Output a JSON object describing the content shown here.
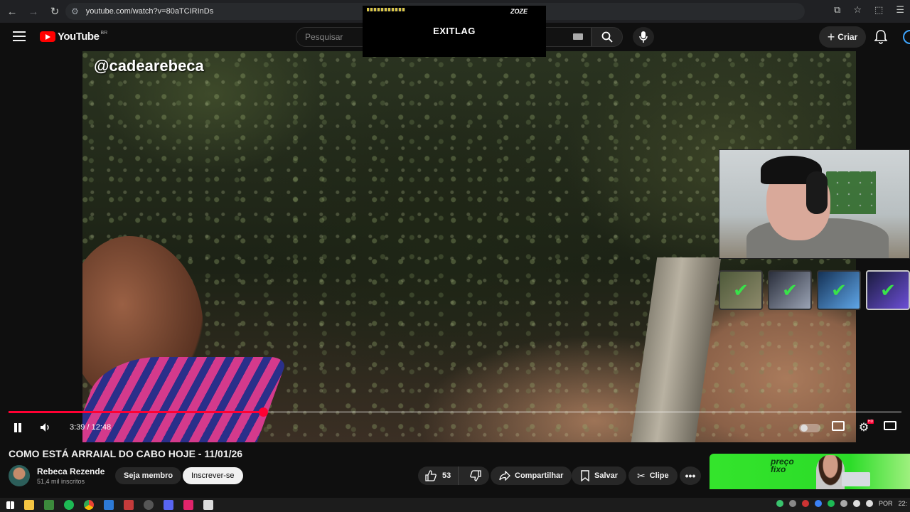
{
  "browser": {
    "url": "youtube.com/watch?v=80aTCIRInDs"
  },
  "header": {
    "logo_text": "YouTube",
    "region": "BR",
    "search_placeholder": "Pesquisar",
    "create_label": "Criar"
  },
  "ad_overlay": {
    "brand": "EXITLAG",
    "tag": "ZOZE"
  },
  "video": {
    "watermark": "@cadearebeca",
    "current_time": "3:39",
    "duration": "12:48",
    "time_display": "3:39 / 12:48",
    "progress_fraction": 0.285,
    "hd_badge": "HD"
  },
  "thumbs": [
    {
      "check": "✔"
    },
    {
      "check": "✔"
    },
    {
      "check": "✔"
    },
    {
      "check": "✔"
    }
  ],
  "info": {
    "title": "COMO ESTÁ ARRAIAL DO CABO HOJE - 11/01/26",
    "channel_name": "Rebeca Rezende",
    "subscribers": "51,4 mil inscritos",
    "member_label": "Seja membro",
    "subscribe_label": "Inscrever-se",
    "likes": "53",
    "share_label": "Compartilhar",
    "save_label": "Salvar",
    "clip_label": "Clipe"
  },
  "ad_banner": {
    "line1": "preço",
    "line2": "fixo"
  },
  "taskbar": {
    "lang": "POR",
    "clock": "22:"
  },
  "colors": {
    "accent_red": "#ff0033",
    "banner_green": "#34e42c"
  }
}
